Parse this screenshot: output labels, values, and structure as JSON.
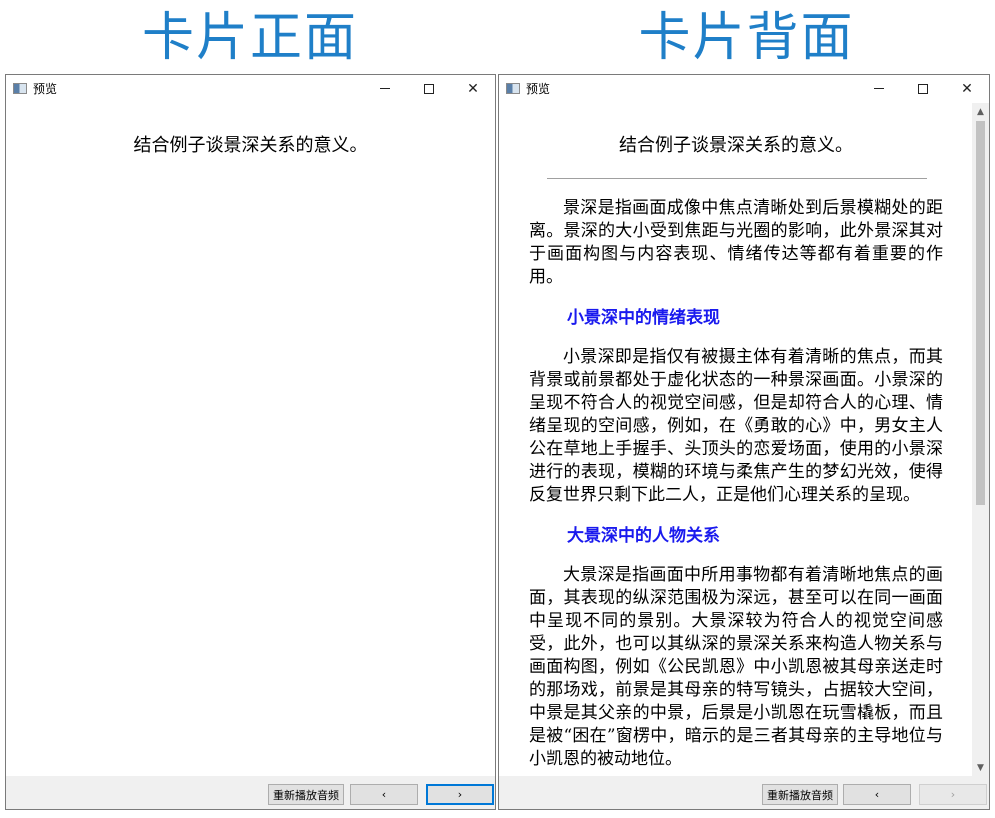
{
  "headings": {
    "front": "卡片正面",
    "back": "卡片背面"
  },
  "window": {
    "title": "预览",
    "controls": {
      "minimize": "–",
      "maximize": "□",
      "close": "✕"
    }
  },
  "card": {
    "question": "结合例子谈景深关系的意义。",
    "intro": "景深是指画面成像中焦点清晰处到后景模糊处的距离。景深的大小受到焦距与光圈的影响，此外景深其对于画面构图与内容表现、情绪传达等都有着重要的作用。",
    "section1_title": "小景深中的情绪表现",
    "section1_text": "小景深即是指仅有被摄主体有着清晰的焦点，而其背景或前景都处于虚化状态的一种景深画面。小景深的呈现不符合人的视觉空间感，但是却符合人的心理、情绪呈现的空间感，例如，在《勇敢的心》中，男女主人公在草地上手握手、头顶头的恋爱场面，使用的小景深进行的表现，模糊的环境与柔焦产生的梦幻光效，使得反复世界只剩下此二人，正是他们心理关系的呈现。",
    "section2_title": "大景深中的人物关系",
    "section2_text": "大景深是指画面中所用事物都有着清晰地焦点的画面，其表现的纵深范围极为深远，甚至可以在同一画面中呈现不同的景别。大景深较为符合人的视觉空间感受，此外，也可以其纵深的景深关系来构造人物关系与画面构图，例如《公民凯恩》中小凯恩被其母亲送走时的那场戏，前景是其母亲的特写镜头，占据较大空间，中景是其父亲的中景，后景是小凯恩在玩雪橇板，而且是被“困在”窗楞中，暗示的是三者其母亲的主导地位与小凯恩的被动地位。"
  },
  "buttons": {
    "replay": "重新播放音频",
    "prev": "‹",
    "next": "›"
  },
  "scroll": {
    "up": "▲",
    "down": "▼"
  },
  "colors": {
    "heading": "#1f7fc8",
    "section_title": "#1a1aee",
    "focus_border": "#0078d7"
  }
}
